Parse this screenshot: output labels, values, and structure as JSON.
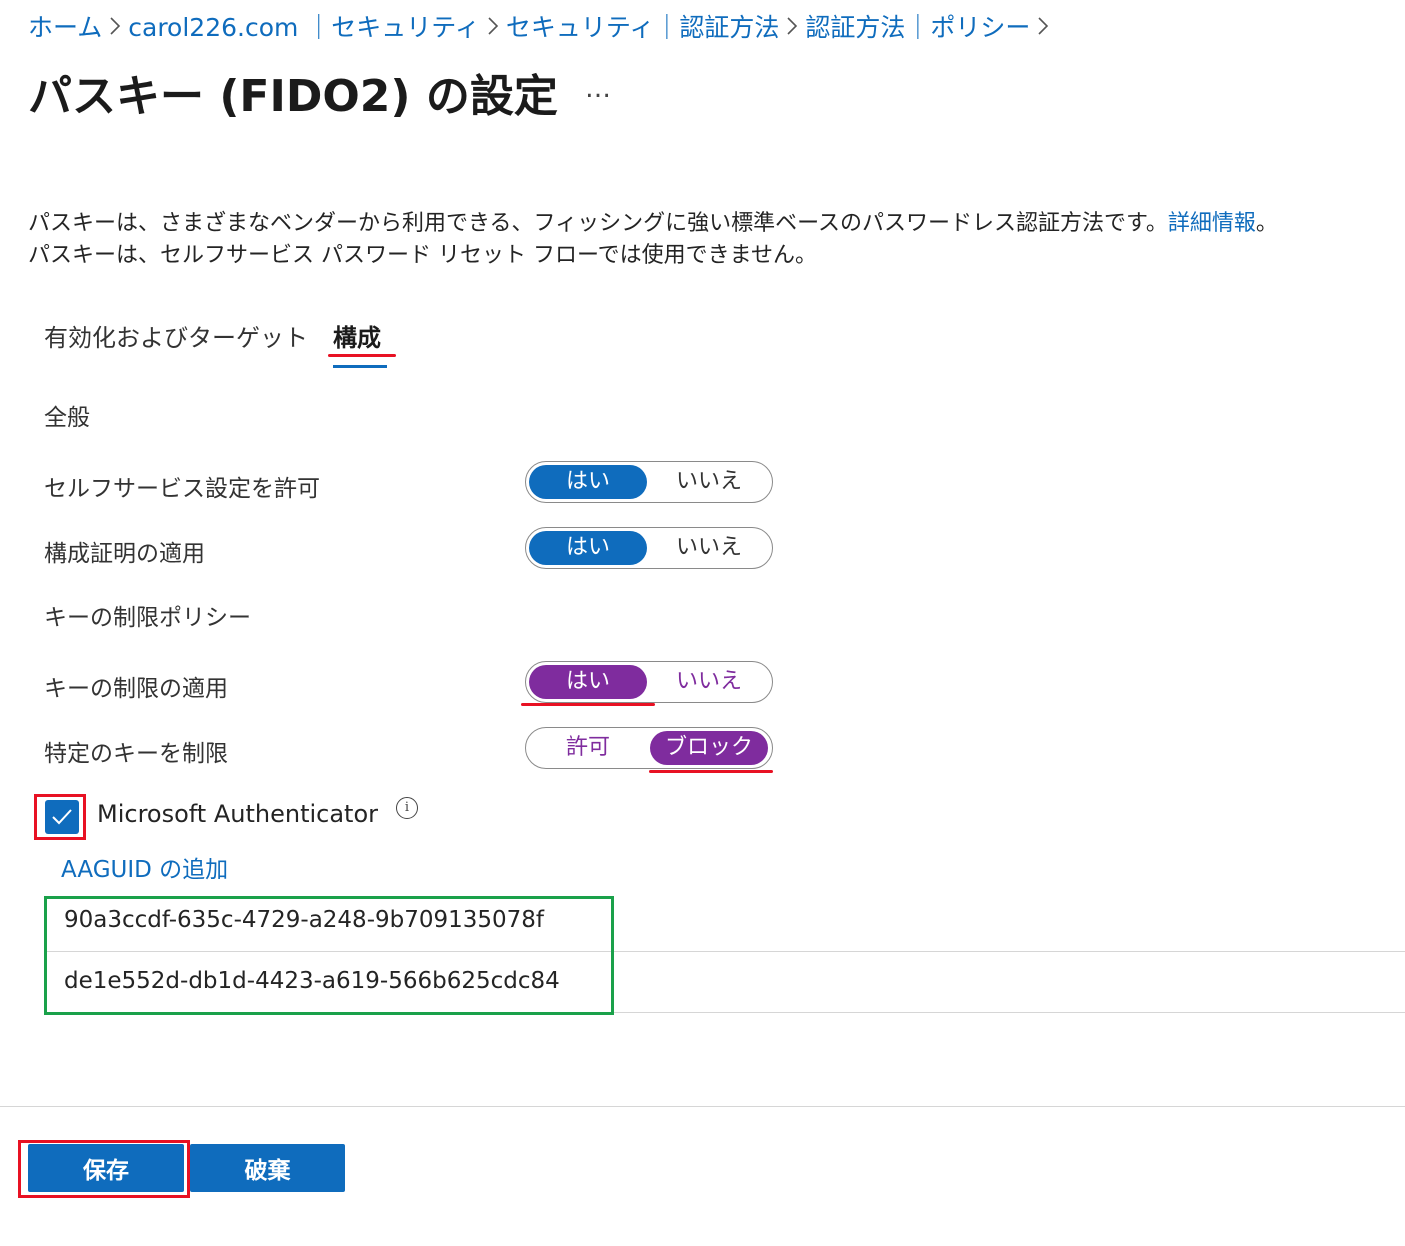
{
  "breadcrumb": [
    {
      "label": "ホーム"
    },
    {
      "label": "carol226.com ｜セキュリティ"
    },
    {
      "label": "セキュリティ｜認証方法"
    },
    {
      "label": "認証方法｜ポリシー"
    }
  ],
  "page": {
    "title": "パスキー (FIDO2) の設定",
    "more": "…"
  },
  "description": {
    "line1": "パスキーは、さまざまなベンダーから利用できる、フィッシングに強い標準ベースのパスワードレス認証方法です。",
    "link": "詳細情報",
    "line1_end": "。",
    "line2": "パスキーは、セルフサービス パスワード リセット フローでは使用できません。"
  },
  "tabs": {
    "enable": "有効化およびターゲット",
    "config": "構成"
  },
  "general": {
    "heading": "全般",
    "self_service": {
      "label": "セルフサービス設定を許可",
      "yes": "はい",
      "no": "いいえ",
      "selected": "はい"
    },
    "attestation": {
      "label": "構成証明の適用",
      "yes": "はい",
      "no": "いいえ",
      "selected": "はい"
    }
  },
  "key_restriction": {
    "heading": "キーの制限ポリシー",
    "enforce": {
      "label": "キーの制限の適用",
      "yes": "はい",
      "no": "いいえ",
      "selected": "はい"
    },
    "restrict": {
      "label": "特定のキーを制限",
      "allow": "許可",
      "block": "ブロック",
      "selected": "ブロック"
    }
  },
  "authenticator": {
    "label": "Microsoft Authenticator",
    "checked": true,
    "info_icon": "i"
  },
  "aaguid": {
    "add_link": "AAGUID の追加",
    "items": [
      "90a3ccdf-635c-4729-a248-9b709135078f",
      "de1e552d-db1d-4423-a619-566b625cdc84"
    ]
  },
  "footer": {
    "save": "保存",
    "discard": "破棄"
  },
  "colors": {
    "accent": "#0f6cbd",
    "purple": "#7f2c9e",
    "highlight_red": "#e81123",
    "highlight_green": "#1aa14a"
  }
}
